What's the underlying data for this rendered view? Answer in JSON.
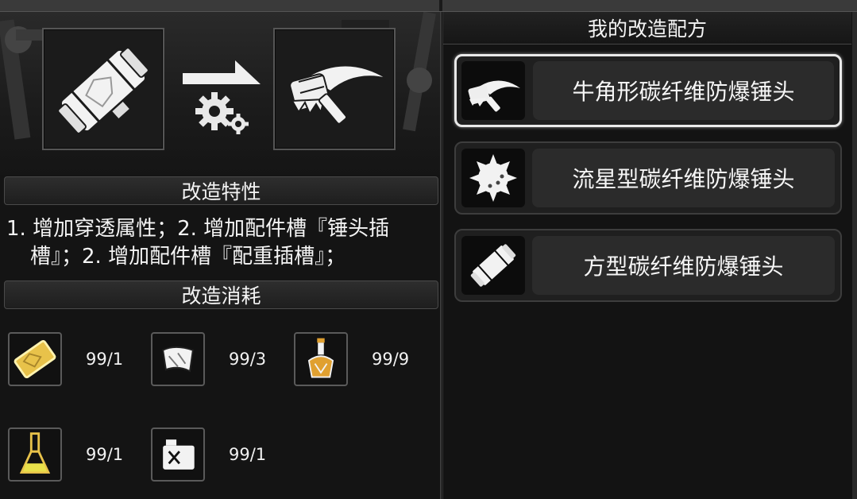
{
  "header": {
    "traits_title": "改造特性",
    "cost_title": "改造消耗",
    "recipes_title": "我的改造配方"
  },
  "conversion": {
    "source_icon": "square-hammer-head-icon",
    "arrow_icon": "arrow-gears-icon",
    "target_icon": "horn-hammer-head-icon"
  },
  "traits": {
    "line1": "1. 增加穿透属性；2. 增加配件槽『锤头插",
    "line2": "槽』；2. 增加配件槽『配重插槽』；"
  },
  "materials": [
    {
      "icon": "gold-plate-icon",
      "count": "99/1"
    },
    {
      "icon": "white-plate-icon",
      "count": "99/3"
    },
    {
      "icon": "orange-potion-flask-icon",
      "count": "99/9"
    },
    {
      "icon": "yellow-liquid-flask-icon",
      "count": "99/1"
    },
    {
      "icon": "canister-icon",
      "count": "99/1"
    }
  ],
  "recipes": [
    {
      "name": "牛角形碳纤维防爆锤头",
      "icon": "horn-hammer-head-icon",
      "selected": true
    },
    {
      "name": "流星型碳纤维防爆锤头",
      "icon": "spiked-ball-icon",
      "selected": false
    },
    {
      "name": "方型碳纤维防爆锤头",
      "icon": "square-hammer-head-icon",
      "selected": false
    }
  ],
  "colors": {
    "accent_gold": "#e8c24a",
    "accent_orange": "#e0a030",
    "panel_bg": "#141414",
    "selected_border": "#e8e8e8"
  }
}
